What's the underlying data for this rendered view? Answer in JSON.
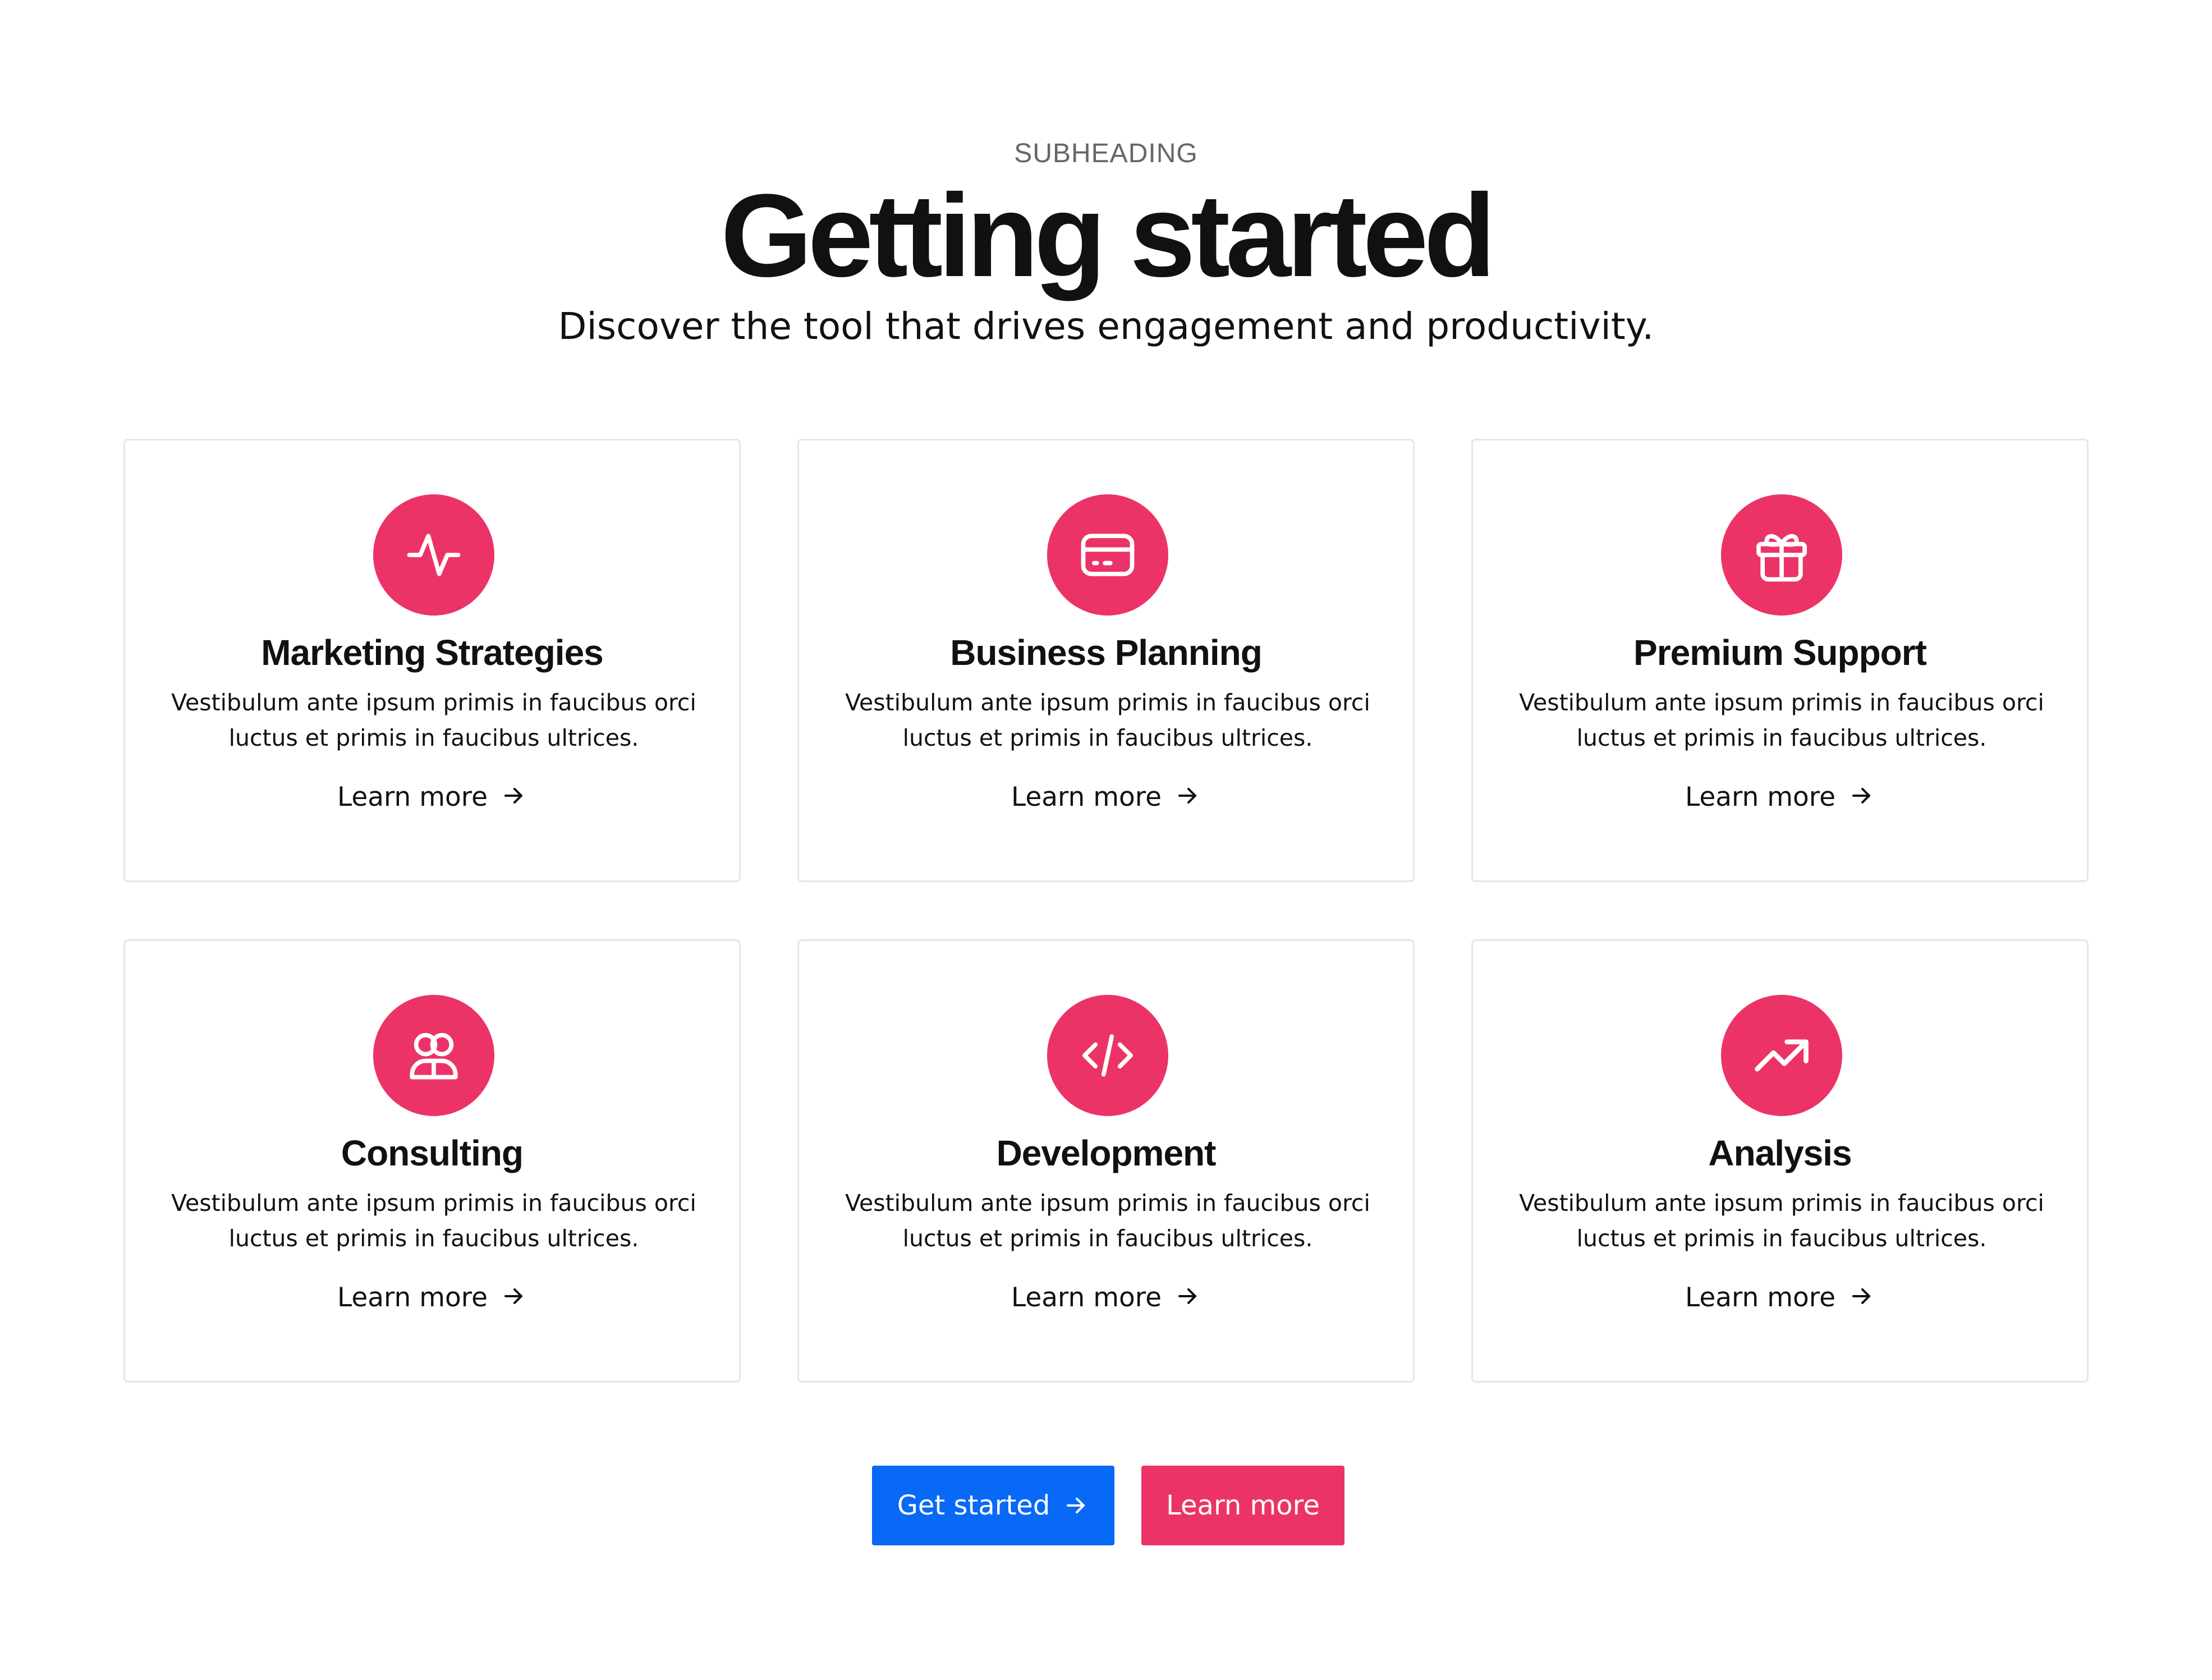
{
  "header": {
    "subheading": "SUBHEADING",
    "title": "Getting started",
    "lead": "Discover the tool that drives engagement and productivity."
  },
  "colors": {
    "accent": "#ec3367",
    "primary_button": "#0969f7",
    "card_border": "#e6e6e6",
    "text": "#111111",
    "subheading": "#666666"
  },
  "cards": [
    {
      "icon": "activity-icon",
      "title": "Marketing Strategies",
      "description": "Vestibulum ante ipsum primis in faucibus orci luctus et primis in faucibus ultrices.",
      "link": "Learn more"
    },
    {
      "icon": "credit-card-icon",
      "title": "Business Planning",
      "description": "Vestibulum ante ipsum primis in faucibus orci luctus et primis in faucibus ultrices.",
      "link": "Learn more"
    },
    {
      "icon": "gift-icon",
      "title": "Premium Support",
      "description": "Vestibulum ante ipsum primis in faucibus orci luctus et primis in faucibus ultrices.",
      "link": "Learn more"
    },
    {
      "icon": "users-icon",
      "title": "Consulting",
      "description": "Vestibulum ante ipsum primis in faucibus orci luctus et primis in faucibus ultrices.",
      "link": "Learn more"
    },
    {
      "icon": "code-icon",
      "title": "Development",
      "description": "Vestibulum ante ipsum primis in faucibus orci luctus et primis in faucibus ultrices.",
      "link": "Learn more"
    },
    {
      "icon": "trending-up-icon",
      "title": "Analysis",
      "description": "Vestibulum ante ipsum primis in faucibus orci luctus et primis in faucibus ultrices.",
      "link": "Learn more"
    }
  ],
  "actions": {
    "primary_label": "Get started",
    "secondary_label": "Learn more"
  }
}
